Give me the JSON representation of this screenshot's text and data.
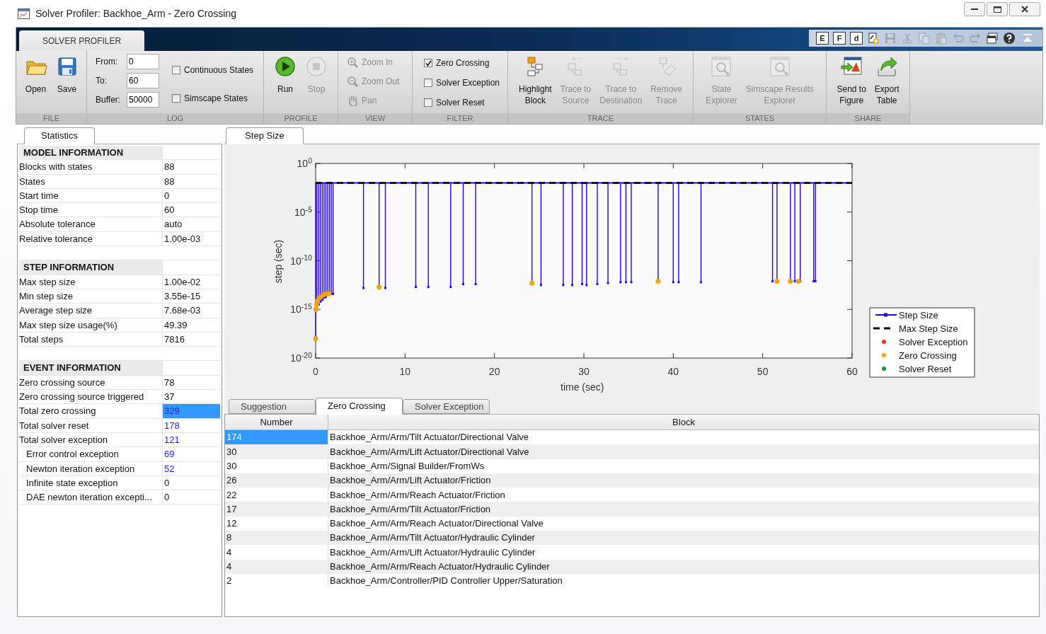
{
  "window": {
    "title": "Solver Profiler: Backhoe_Arm - Zero Crossing"
  },
  "ribbon": {
    "tabs": [
      {
        "label": "SOLVER PROFILER",
        "selected": true
      }
    ],
    "quick_access": [
      {
        "kind": "letter",
        "label": "E",
        "disabled": false
      },
      {
        "kind": "letter",
        "label": "F",
        "disabled": false
      },
      {
        "kind": "letter",
        "label": "d",
        "disabled": false
      },
      {
        "kind": "new",
        "disabled": false
      },
      {
        "kind": "save",
        "disabled": true
      },
      {
        "kind": "cut",
        "disabled": true
      },
      {
        "kind": "copy",
        "disabled": true
      },
      {
        "kind": "paste",
        "disabled": true
      },
      {
        "kind": "undo",
        "disabled": true
      },
      {
        "kind": "redo",
        "disabled": true
      },
      {
        "kind": "window",
        "disabled": false
      },
      {
        "kind": "help",
        "disabled": false
      }
    ],
    "groups": [
      {
        "kind": "buttons",
        "label": "FILE",
        "items": [
          {
            "lines": [
              "Open"
            ],
            "disabled": false
          },
          {
            "lines": [
              "Save"
            ],
            "disabled": false
          }
        ]
      },
      {
        "kind": "log",
        "label": "LOG",
        "fields": [
          {
            "label": "From:",
            "value": "0"
          },
          {
            "label": "To:",
            "value": "60"
          },
          {
            "label": "Buffer:",
            "value": "50000"
          }
        ],
        "checkboxes": [
          {
            "label": "Continuous States",
            "checked": false
          },
          {
            "label": "Simscape States",
            "checked": false
          }
        ]
      },
      {
        "kind": "buttons",
        "label": "PROFILE",
        "items": [
          {
            "lines": [
              "Run"
            ],
            "disabled": false
          },
          {
            "lines": [
              "Stop"
            ],
            "disabled": true
          }
        ]
      },
      {
        "kind": "list",
        "label": "VIEW",
        "items": [
          {
            "label": "Zoom In",
            "disabled": true
          },
          {
            "label": "Zoom Out",
            "disabled": true
          },
          {
            "label": "Pan",
            "disabled": true
          }
        ]
      },
      {
        "kind": "checks",
        "label": "FILTER",
        "items": [
          {
            "label": "Zero Crossing",
            "checked": true
          },
          {
            "label": "Solver Exception",
            "checked": false
          },
          {
            "label": "Solver Reset",
            "checked": false
          }
        ]
      },
      {
        "kind": "buttons",
        "label": "TRACE",
        "items": [
          {
            "lines": [
              "Highlight",
              "Block"
            ],
            "disabled": false
          },
          {
            "lines": [
              "Trace to",
              "Source"
            ],
            "disabled": true
          },
          {
            "lines": [
              "Trace to",
              "Destination"
            ],
            "disabled": true
          },
          {
            "lines": [
              "Remove",
              "Trace"
            ],
            "disabled": true
          }
        ]
      },
      {
        "kind": "buttons",
        "label": "STATES",
        "items": [
          {
            "lines": [
              "State",
              "Explorer"
            ],
            "disabled": true
          },
          {
            "lines": [
              "Simscape Results",
              "Explorer"
            ],
            "disabled": true
          }
        ]
      },
      {
        "kind": "buttons",
        "label": "SHARE",
        "items": [
          {
            "lines": [
              "Send to",
              "Figure"
            ],
            "disabled": false
          },
          {
            "lines": [
              "Export",
              "Table"
            ],
            "disabled": false
          }
        ]
      }
    ]
  },
  "statistics": {
    "tabs": [
      {
        "label": "Statistics",
        "selected": true
      }
    ],
    "sections": [
      {
        "title": "MODEL INFORMATION",
        "rows": [
          {
            "label": "Blocks with states",
            "value": "88",
            "link": false,
            "selected": false
          },
          {
            "label": "States",
            "value": "88",
            "link": false,
            "selected": false
          },
          {
            "label": "Start time",
            "value": "0",
            "link": false,
            "selected": false
          },
          {
            "label": "Stop time",
            "value": "60",
            "link": false,
            "selected": false
          },
          {
            "label": "Absolute tolerance",
            "value": "auto",
            "link": false,
            "selected": false
          },
          {
            "label": "Relative tolerance",
            "value": "1.00e-03",
            "link": false,
            "selected": false
          }
        ]
      },
      {
        "title": "STEP INFORMATION",
        "rows": [
          {
            "label": "Max step size",
            "value": "1.00e-02",
            "link": false,
            "selected": false
          },
          {
            "label": "Min step size",
            "value": "3.55e-15",
            "link": false,
            "selected": false
          },
          {
            "label": "Average step size",
            "value": "7.68e-03",
            "link": false,
            "selected": false
          },
          {
            "label": "Max step size usage(%)",
            "value": "49.39",
            "link": false,
            "selected": false
          },
          {
            "label": "Total steps",
            "value": "7816",
            "link": false,
            "selected": false
          }
        ]
      },
      {
        "title": "EVENT INFORMATION",
        "rows": [
          {
            "label": "Zero crossing source",
            "value": "78",
            "link": false,
            "selected": false
          },
          {
            "label": "Zero crossing source triggered",
            "value": "37",
            "link": false,
            "selected": false
          },
          {
            "label": "Total zero crossing",
            "value": "329",
            "link": true,
            "selected": true
          },
          {
            "label": "Total solver reset",
            "value": "178",
            "link": true,
            "selected": false
          },
          {
            "label": "Total solver exception",
            "value": "121",
            "link": true,
            "selected": false,
            "children": [
              {
                "label": "Error control exception",
                "value": "69",
                "link": true,
                "selected": false
              },
              {
                "label": "Newton iteration exception",
                "value": "52",
                "link": true,
                "selected": false
              },
              {
                "label": "Infinite state exception",
                "value": "0",
                "link": false,
                "selected": false
              },
              {
                "label": "DAE newton iteration excepti...",
                "value": "0",
                "link": false,
                "selected": false
              }
            ]
          }
        ]
      }
    ]
  },
  "plot": {
    "tabs": [
      {
        "label": "Step Size",
        "selected": true
      }
    ],
    "xlabel": "time (sec)",
    "ylabel": "step (sec)",
    "xticks": [
      "0",
      "10",
      "20",
      "30",
      "40",
      "50",
      "60"
    ],
    "yticks": [
      "10$^{0}$",
      "10$^{-5}$",
      "10$^{-10}$",
      "10$^{-15}$",
      "10$^{-20}$"
    ],
    "legend": [
      {
        "name": "Step Size",
        "color": "#2400ff"
      },
      {
        "name": "Max Step Size",
        "color": "#000000"
      },
      {
        "name": "Solver Exception",
        "color": "#e8372c"
      },
      {
        "name": "Zero Crossing",
        "color": "#f0a30a"
      },
      {
        "name": "Solver Reset",
        "color": "#0a9a2a"
      }
    ]
  },
  "details": {
    "tabs": [
      {
        "label": "Suggestion",
        "selected": false
      },
      {
        "label": "Zero Crossing",
        "selected": true
      },
      {
        "label": "Solver Exception",
        "selected": false
      }
    ],
    "columns": [
      "Number",
      "Block"
    ],
    "rows": [
      {
        "number": "174",
        "block": "Backhoe_Arm/Arm/Tilt Actuator/Directional Valve",
        "selected": true
      },
      {
        "number": "30",
        "block": "Backhoe_Arm/Arm/Lift Actuator/Directional Valve",
        "selected": false
      },
      {
        "number": "30",
        "block": "Backhoe_Arm/Signal Builder/FromWs",
        "selected": false
      },
      {
        "number": "26",
        "block": "Backhoe_Arm/Arm/Lift Actuator/Friction",
        "selected": false
      },
      {
        "number": "22",
        "block": "Backhoe_Arm/Arm/Reach Actuator/Friction",
        "selected": false
      },
      {
        "number": "17",
        "block": "Backhoe_Arm/Arm/Tilt Actuator/Friction",
        "selected": false
      },
      {
        "number": "12",
        "block": "Backhoe_Arm/Arm/Reach Actuator/Directional Valve",
        "selected": false
      },
      {
        "number": "8",
        "block": "Backhoe_Arm/Arm/Tilt Actuator/Hydraulic Cylinder",
        "selected": false
      },
      {
        "number": "4",
        "block": "Backhoe_Arm/Arm/Lift Actuator/Hydraulic Cylinder",
        "selected": false
      },
      {
        "number": "4",
        "block": "Backhoe_Arm/Arm/Reach Actuator/Hydraulic Cylinder",
        "selected": false
      },
      {
        "number": "2",
        "block": "Backhoe_Arm/Controller/PID Controller Upper/Saturation",
        "selected": false
      }
    ]
  }
}
